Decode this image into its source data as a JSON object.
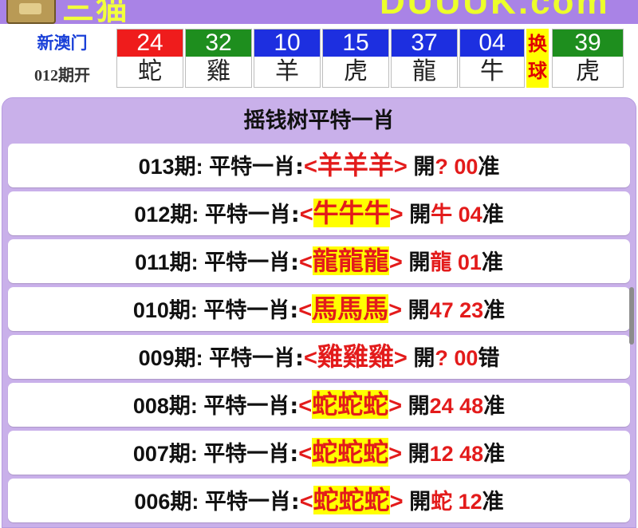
{
  "banner": {
    "left_text": "三猫",
    "right_text": "DUUUK.com"
  },
  "draw": {
    "region": "新澳门",
    "period": "012期开",
    "balls": [
      {
        "number": "24",
        "zodiac": "蛇",
        "color": "#ef1c1c"
      },
      {
        "number": "32",
        "zodiac": "雞",
        "color": "#1e8e1e"
      },
      {
        "number": "10",
        "zodiac": "羊",
        "color": "#1d2fe0"
      },
      {
        "number": "15",
        "zodiac": "虎",
        "color": "#1d2fe0"
      },
      {
        "number": "37",
        "zodiac": "龍",
        "color": "#1d2fe0"
      },
      {
        "number": "04",
        "zodiac": "牛",
        "color": "#1d2fe0"
      }
    ],
    "swap_label": "换球",
    "special": {
      "number": "39",
      "zodiac": "虎",
      "color": "#1e8e1e"
    }
  },
  "panel": {
    "title": "摇钱树平特一肖",
    "rows": [
      {
        "period": "013期:",
        "label": "平特一肖:",
        "pick": "羊羊羊",
        "open_label": "開",
        "result": "? 00",
        "verdict": "准",
        "highlight": false
      },
      {
        "period": "012期:",
        "label": "平特一肖:",
        "pick": "牛牛牛",
        "open_label": "開",
        "result": "牛 04",
        "verdict": "准",
        "highlight": true
      },
      {
        "period": "011期:",
        "label": "平特一肖:",
        "pick": "龍龍龍",
        "open_label": "開",
        "result": "龍 01",
        "verdict": "准",
        "highlight": true
      },
      {
        "period": "010期:",
        "label": "平特一肖:",
        "pick": "馬馬馬",
        "open_label": "開",
        "result": "47 23",
        "verdict": "准",
        "highlight": true
      },
      {
        "period": "009期:",
        "label": "平特一肖:",
        "pick": "雞雞雞",
        "open_label": "開",
        "result": "? 00",
        "verdict": "错",
        "highlight": false
      },
      {
        "period": "008期:",
        "label": "平特一肖:",
        "pick": "蛇蛇蛇",
        "open_label": "開",
        "result": "24 48",
        "verdict": "准",
        "highlight": true
      },
      {
        "period": "007期:",
        "label": "平特一肖:",
        "pick": "蛇蛇蛇",
        "open_label": "開",
        "result": "12 48",
        "verdict": "准",
        "highlight": true
      },
      {
        "period": "006期:",
        "label": "平特一肖:",
        "pick": "蛇蛇蛇",
        "open_label": "開",
        "result": "蛇 12",
        "verdict": "准",
        "highlight": true
      }
    ]
  },
  "colors": {
    "banner_bg": "#a983e6",
    "panel_bg": "#c9b0ea",
    "accent_red": "#e31b1b",
    "highlight_yellow": "#ffff00",
    "region_blue": "#1a40d8"
  }
}
